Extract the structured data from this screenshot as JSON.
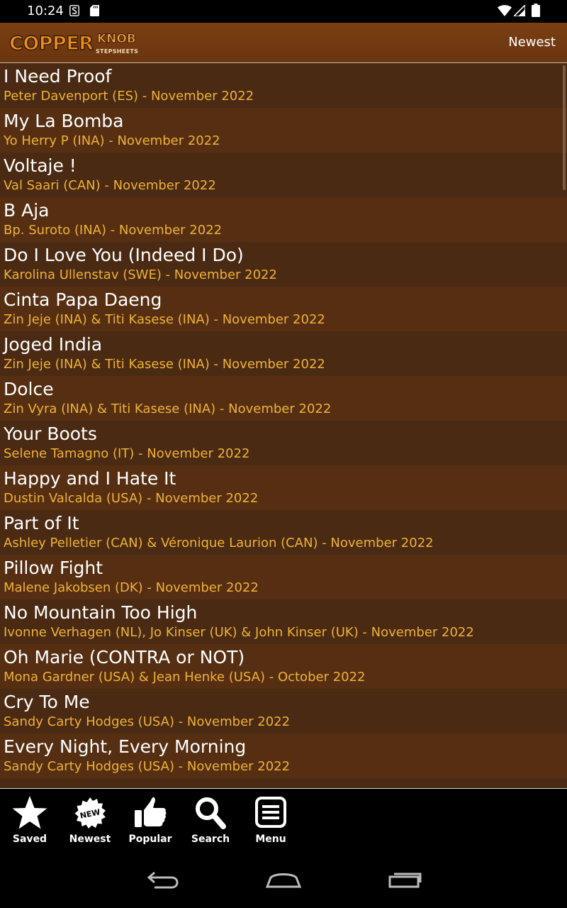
{
  "status_bar": {
    "time": "10:24"
  },
  "app_bar": {
    "logo_text": "COPPERKNOB STEPSHEETS",
    "action_label": "Newest"
  },
  "list": {
    "items": [
      {
        "title": "I Need Proof",
        "subtitle": "Peter Davenport (ES) - November 2022"
      },
      {
        "title": "My La Bomba",
        "subtitle": "Yo Herry P (INA) - November 2022"
      },
      {
        "title": "Voltaje !",
        "subtitle": "Val Saari (CAN) - November 2022"
      },
      {
        "title": "B Aja",
        "subtitle": "Bp. Suroto (INA) - November 2022"
      },
      {
        "title": "Do I Love You (Indeed I Do)",
        "subtitle": "Karolina Ullenstav (SWE) - November 2022"
      },
      {
        "title": "Cinta Papa Daeng",
        "subtitle": "Zin Jeje (INA) & Titi Kasese (INA) - November 2022"
      },
      {
        "title": "Joged India",
        "subtitle": "Zin Jeje (INA) & Titi Kasese (INA) - November 2022"
      },
      {
        "title": "Dolce",
        "subtitle": "Zin Vyra (INA) & Titi Kasese (INA) - November 2022"
      },
      {
        "title": "Your Boots",
        "subtitle": "Selene Tamagno (IT) - November 2022"
      },
      {
        "title": "Happy and I Hate It",
        "subtitle": "Dustin Valcalda (USA) - November 2022"
      },
      {
        "title": "Part of It",
        "subtitle": "Ashley Pelletier (CAN) & Véronique Laurion (CAN) - November 2022"
      },
      {
        "title": "Pillow Fight",
        "subtitle": "Malene Jakobsen (DK) - November 2022"
      },
      {
        "title": "No Mountain Too High",
        "subtitle": "Ivonne Verhagen (NL), Jo Kinser (UK) & John Kinser (UK) - November 2022"
      },
      {
        "title": "Oh Marie (CONTRA or NOT)",
        "subtitle": "Mona Gardner (USA) & Jean Henke (USA) - October 2022"
      },
      {
        "title": "Cry To Me",
        "subtitle": "Sandy Carty Hodges (USA) - November 2022"
      },
      {
        "title": "Every Night, Every Morning",
        "subtitle": "Sandy Carty Hodges (USA) - November 2022"
      }
    ]
  },
  "tab_bar": {
    "tabs": [
      {
        "label": "Saved",
        "icon": "star-icon"
      },
      {
        "label": "Newest",
        "icon": "new-badge-icon"
      },
      {
        "label": "Popular",
        "icon": "thumbs-up-icon"
      },
      {
        "label": "Search",
        "icon": "search-icon"
      },
      {
        "label": "Menu",
        "icon": "menu-icon"
      }
    ]
  },
  "colors": {
    "app_bar": "#7a3f12",
    "list_bg_odd": "#4a2a12",
    "list_bg_even": "#562f13",
    "subtitle": "#f0b234",
    "logo_orange": "#e8901a"
  }
}
